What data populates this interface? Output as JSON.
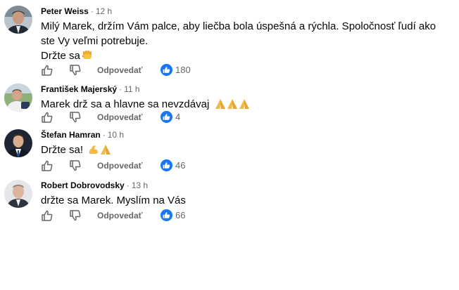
{
  "colors": {
    "accent": "#1877f2",
    "muted": "#65676b",
    "text": "#050505"
  },
  "comments": [
    {
      "author": "Peter Weiss",
      "time": "12 h",
      "lines": [
        "Milý Marek, držím Vám palce, aby liečba bola úspešná a rýchla. Spoločnosť ľudí ako ste Vy veľmi potrebuje.",
        "Držte sa"
      ],
      "emoji": "fist-emoji",
      "reply_label": "Odpovedať",
      "reaction_count": "180"
    },
    {
      "author": "František Majerský",
      "time": "11 h",
      "lines": [
        "Marek drž sa a hlavne sa nevzdávaj"
      ],
      "emoji": "praying-hands-emoji x3",
      "reply_label": "Odpovedať",
      "reaction_count": "4"
    },
    {
      "author": "Štefan Hamran",
      "time": "10 h",
      "lines": [
        "Držte sa!"
      ],
      "emoji": "flexed-biceps-emoji praying-hands-emoji",
      "reply_label": "Odpovedať",
      "reaction_count": "46"
    },
    {
      "author": "Robert Dobrovodsky",
      "time": "13 h",
      "lines": [
        "držte sa Marek. Myslím na Vás"
      ],
      "reply_label": "Odpovedať",
      "reaction_count": "66"
    }
  ]
}
